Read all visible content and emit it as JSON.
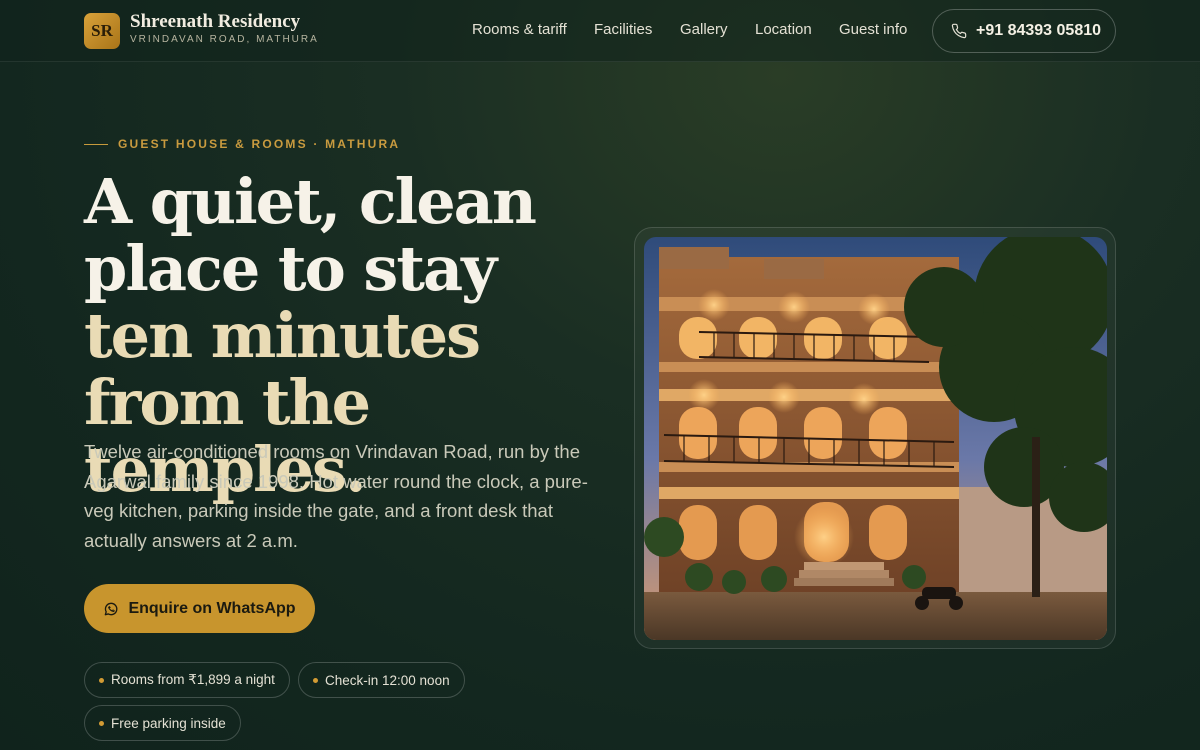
{
  "brand": {
    "initials": "SR",
    "name": "Shreenath Residency",
    "subtitle": "VRINDAVAN ROAD, MATHURA"
  },
  "nav": {
    "items": [
      {
        "label": "Rooms & tariff"
      },
      {
        "label": "Facilities"
      },
      {
        "label": "Gallery"
      },
      {
        "label": "Location"
      },
      {
        "label": "Guest info"
      }
    ],
    "phone": "+91 84393 05810",
    "phone_icon": "phone-icon"
  },
  "hero": {
    "eyebrow": "GUEST HOUSE & ROOMS · MATHURA",
    "headline_main": "A quiet, clean place to stay",
    "headline_accent": "ten minutes from the temples.",
    "lede": "Twelve air-conditioned rooms on Vrindavan Road, run by the Agarwal family since 1998. Hot water round the clock, a pure-veg kitchen, parking inside the gate, and a front desk that actually answers at 2 a.m.",
    "cta_label": "Enquire on WhatsApp",
    "cta_icon": "whatsapp-icon",
    "chips": [
      {
        "label": "Rooms from ₹1,899 a night"
      },
      {
        "label": "Check-in 12:00 noon"
      },
      {
        "label": "Free parking inside"
      }
    ]
  },
  "colors": {
    "background": "#13271f",
    "accent": "#c8952d",
    "headline_accent": "#e9dbb5"
  }
}
